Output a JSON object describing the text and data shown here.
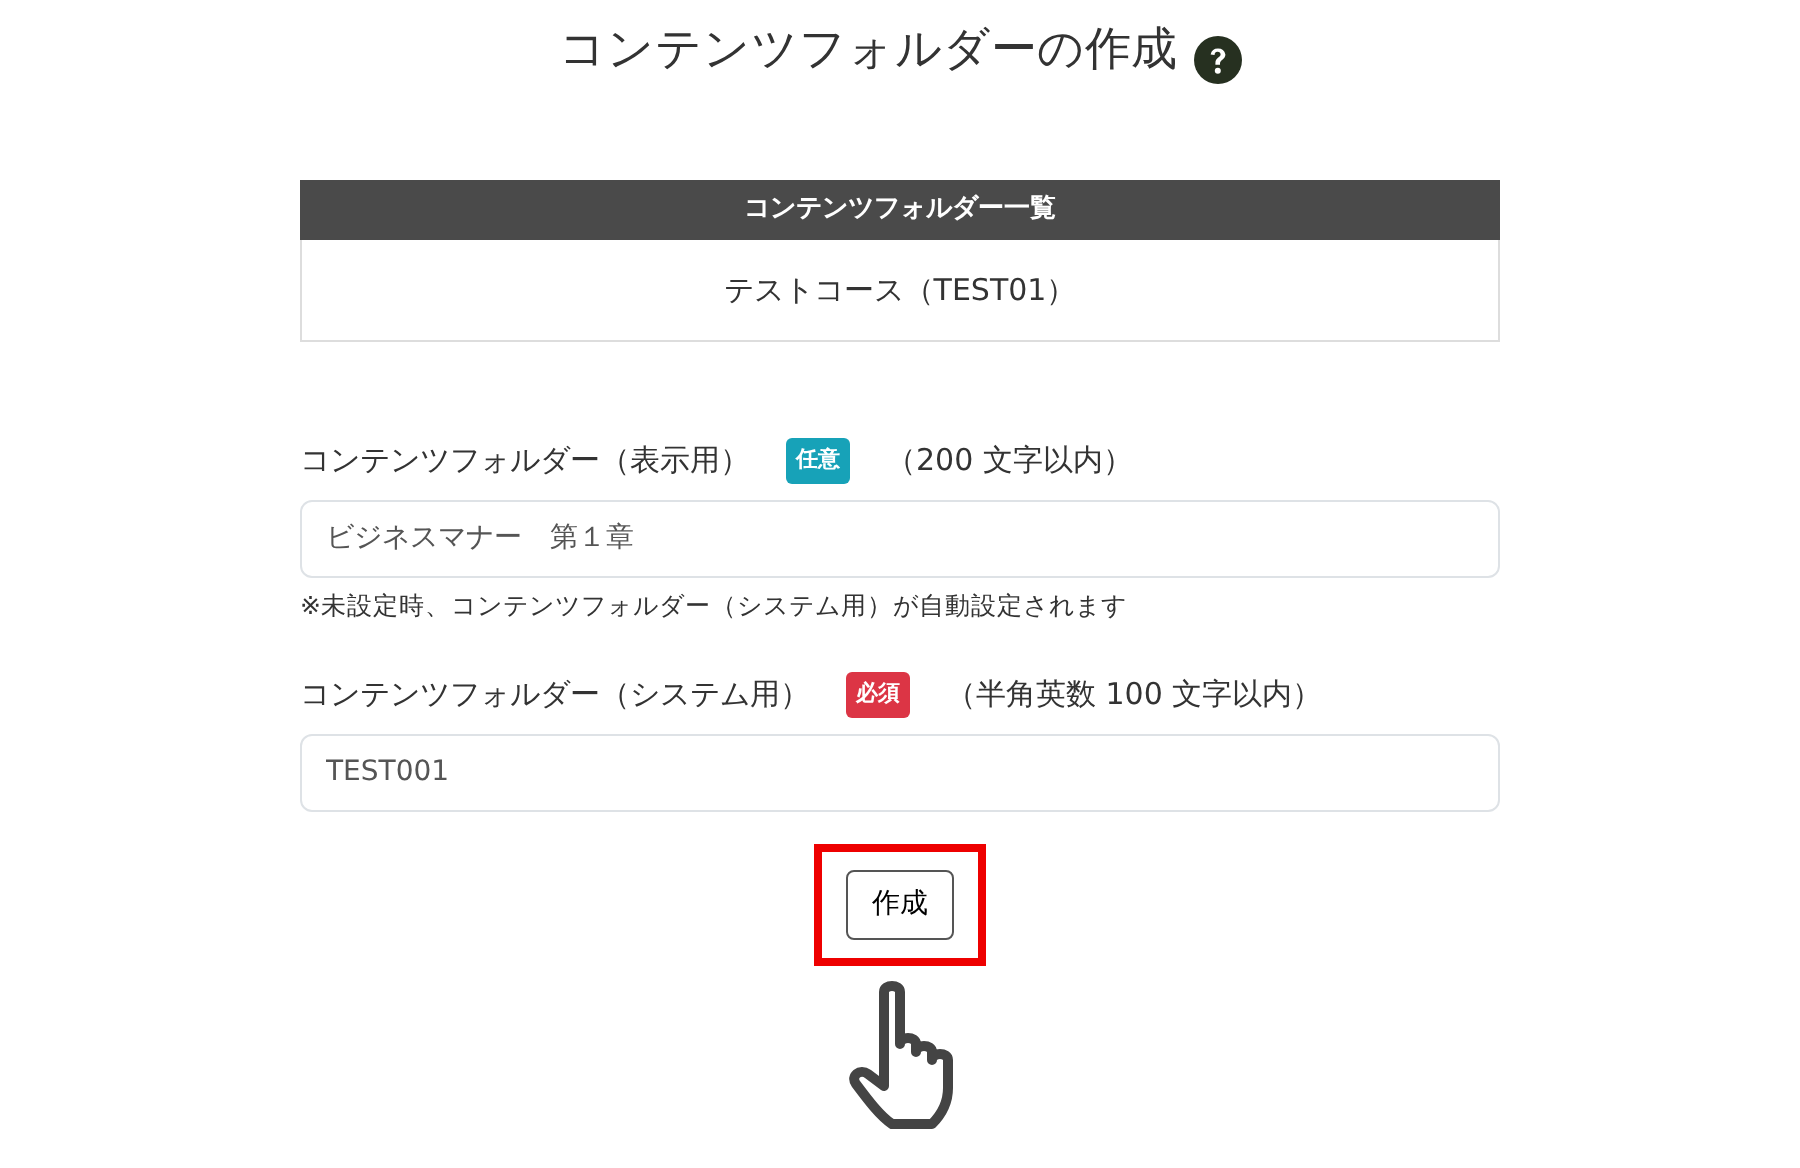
{
  "page_title": "コンテンツフォルダーの作成",
  "folder_list": {
    "heading": "コンテンツフォルダー一覧",
    "rows": [
      "テストコース（TEST01）"
    ]
  },
  "fields": [
    {
      "label": "コンテンツフォルダー（表示用）",
      "badge": {
        "text": "任意",
        "kind": "optional"
      },
      "limit": "（200 文字以内）",
      "value": "ビジネスマナー　第１章",
      "note": "※未設定時、コンテンツフォルダー（システム用）が自動設定されます"
    },
    {
      "label": "コンテンツフォルダー（システム用）",
      "badge": {
        "text": "必須",
        "kind": "required"
      },
      "limit": "（半角英数 100 文字以内）",
      "value": "TEST001"
    }
  ],
  "submit_button": {
    "label": "作成",
    "highlighted": true
  }
}
